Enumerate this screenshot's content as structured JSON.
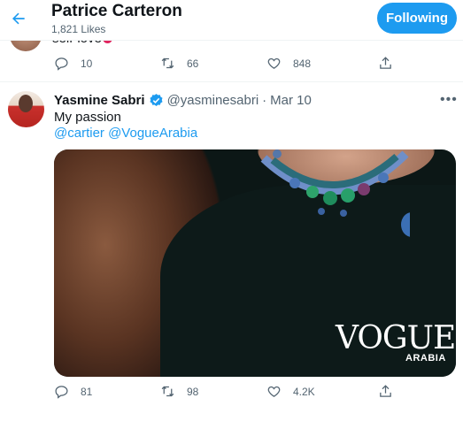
{
  "header": {
    "title": "Patrice Carteron",
    "subtitle": "1,821 Likes",
    "follow_label": "Following"
  },
  "previous_tweet": {
    "text_tail": "self-love",
    "replies": "10",
    "retweets": "66",
    "likes": "848"
  },
  "tweet": {
    "author_name": "Yasmine Sabri",
    "handle": "@yasminesabri",
    "separator": "·",
    "date": "Mar 10",
    "text": "My passion",
    "mentions": "@cartier @VogueArabia",
    "media": {
      "logo_text": "VOGUE",
      "logo_sub": "ARABIA"
    },
    "replies": "81",
    "retweets": "98",
    "likes": "4.2K"
  },
  "colors": {
    "accent": "#1d9bf0",
    "muted": "#536471",
    "heart": "#e0245e"
  },
  "icons": [
    "back-arrow-icon",
    "reply-icon",
    "retweet-icon",
    "like-icon",
    "share-icon",
    "verified-icon",
    "more-icon"
  ]
}
